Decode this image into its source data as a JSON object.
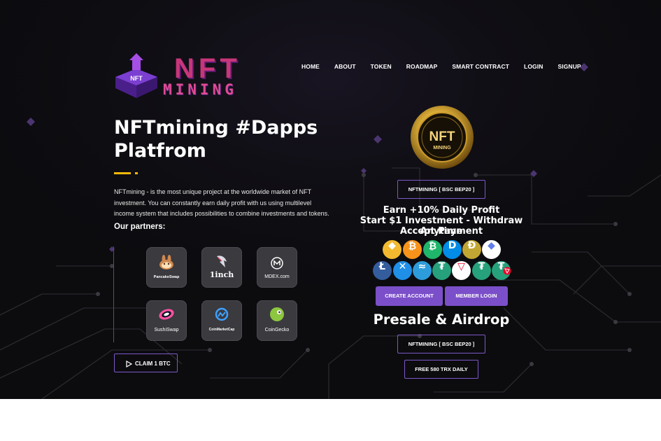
{
  "brand": {
    "name": "NFT",
    "subname": "MINING",
    "gem_label": "NFT"
  },
  "nav": {
    "items": [
      "HOME",
      "ABOUT",
      "TOKEN",
      "ROADMAP",
      "SMART CONTRACT",
      "LOGIN",
      "SIGNUP"
    ]
  },
  "hero": {
    "title": "NFTmining #Dapps Platfrom",
    "description": "NFTmining - is the most unique project at the worldwide market of NFT investment. You can constantly earn daily profit with us using multilevel income system that includes possibilities to combine investments and tokens.",
    "partners_title": "Our partners:",
    "accent_color": "#f5b90a"
  },
  "partners": [
    {
      "name": "PancakeSwap",
      "icon": "pancakeswap-icon"
    },
    {
      "name": "1inch",
      "icon": "1inch-icon"
    },
    {
      "name": "MDEX.com",
      "icon": "mdex-icon"
    },
    {
      "name": "SushiSwap",
      "icon": "sushiswap-icon"
    },
    {
      "name": "CoinMarketCap",
      "icon": "coinmarketcap-icon"
    },
    {
      "name": "CoinGecko",
      "icon": "coingecko-icon"
    }
  ],
  "claim_button": {
    "label": "CLAIM 1 BTC",
    "icon": "play-icon"
  },
  "coin_badge": {
    "text": "NFT",
    "subtext": "MINING"
  },
  "token_button": "NFTMINING [ BSC BEP20 ]",
  "info": {
    "earn": "Earn +10% Daily Profit",
    "start": "Start $1 Investment - Withdraw Anytime",
    "accept": "Accept Payment"
  },
  "payment_methods": [
    {
      "name": "binance-coin",
      "symbol": "◆",
      "color": "#f3ba2f"
    },
    {
      "name": "bitcoin",
      "symbol": "₿",
      "color": "#f7931a"
    },
    {
      "name": "bitcoin-cash",
      "symbol": "₿",
      "color": "#1fb56b"
    },
    {
      "name": "dash",
      "symbol": "D",
      "color": "#008ce7"
    },
    {
      "name": "dogecoin",
      "symbol": "Ð",
      "color": "#c2a633"
    },
    {
      "name": "ethereum",
      "symbol": "◆",
      "color": "#ffffff"
    },
    {
      "name": "litecoin",
      "symbol": "Ł",
      "color": "#345d9d"
    },
    {
      "name": "ripple",
      "symbol": "✕",
      "color": "#1f8fe8"
    },
    {
      "name": "stellar",
      "symbol": "≈",
      "color": "#2d9cdb"
    },
    {
      "name": "tether",
      "symbol": "₮",
      "color": "#26a17b"
    },
    {
      "name": "tron",
      "symbol": "▽",
      "color": "#ef0027"
    },
    {
      "name": "tether",
      "symbol": "₮",
      "color": "#26a17b"
    },
    {
      "name": "tether-trc20",
      "symbol": "₮",
      "color": "#26a17b"
    }
  ],
  "actions": {
    "create": "CREATE ACCOUNT",
    "login": "MEMBER LOGIN",
    "button_color": "#7b4fc9"
  },
  "presale": {
    "title": "Presale & Airdrop",
    "token_button": "NFTMINING [ BSC BEP20 ]",
    "trx_button": "FREE 580 TRX DAILY"
  }
}
